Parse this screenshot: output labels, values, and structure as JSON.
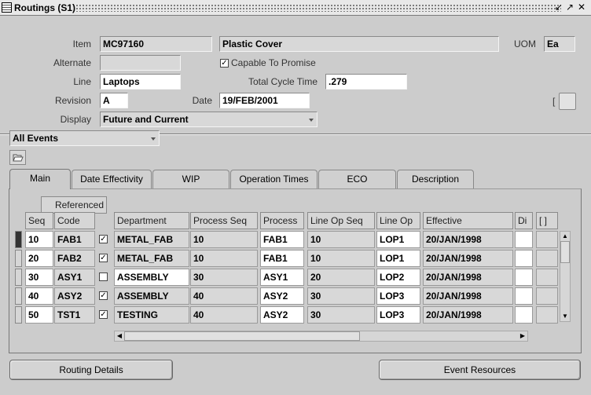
{
  "window": {
    "title": "Routings (S1)"
  },
  "header": {
    "item_label": "Item",
    "item_value": "MC97160",
    "item_desc": "Plastic Cover",
    "uom_label": "UOM",
    "uom_value": "Ea",
    "alternate_label": "Alternate",
    "alternate_value": "",
    "ctp_label": "Capable To Promise",
    "ctp_checked": "✓",
    "line_label": "Line",
    "line_value": "Laptops",
    "cycle_label": "Total Cycle Time",
    "cycle_value": ".279",
    "revision_label": "Revision",
    "revision_value": "A",
    "date_label": "Date",
    "date_value": "19/FEB/2001",
    "display_label": "Display",
    "display_value": "Future and Current",
    "bracket": "[",
    "events_value": "All Events"
  },
  "tabs": [
    {
      "label": "Main"
    },
    {
      "label": "Date Effectivity"
    },
    {
      "label": "WIP"
    },
    {
      "label": "Operation Times"
    },
    {
      "label": "ECO"
    },
    {
      "label": "Description"
    }
  ],
  "table": {
    "group_header": "Referenced",
    "headers": [
      "Seq",
      "Code",
      "Department",
      "Process Seq",
      "Process",
      "Line Op Seq",
      "Line Op",
      "Effective",
      "Di",
      "[ ]"
    ],
    "rows": [
      {
        "seq": "10",
        "code": "FAB1",
        "ref": "✓",
        "dept": "METAL_FAB",
        "pseq": "10",
        "proc": "FAB1",
        "lopseq": "10",
        "lop": "LOP1",
        "eff": "20/JAN/1998"
      },
      {
        "seq": "20",
        "code": "FAB2",
        "ref": "✓",
        "dept": "METAL_FAB",
        "pseq": "10",
        "proc": "FAB1",
        "lopseq": "10",
        "lop": "LOP1",
        "eff": "20/JAN/1998"
      },
      {
        "seq": "30",
        "code": "ASY1",
        "ref": "",
        "dept": "ASSEMBLY",
        "pseq": "30",
        "proc": "ASY1",
        "lopseq": "20",
        "lop": "LOP2",
        "eff": "20/JAN/1998"
      },
      {
        "seq": "40",
        "code": "ASY2",
        "ref": "✓",
        "dept": "ASSEMBLY",
        "pseq": "40",
        "proc": "ASY2",
        "lopseq": "30",
        "lop": "LOP3",
        "eff": "20/JAN/1998"
      },
      {
        "seq": "50",
        "code": "TST1",
        "ref": "✓",
        "dept": "TESTING",
        "pseq": "40",
        "proc": "ASY2",
        "lopseq": "30",
        "lop": "LOP3",
        "eff": "20/JAN/1998"
      }
    ]
  },
  "buttons": {
    "routing_details": "Routing Details",
    "event_resources": "Event Resources"
  },
  "icons": {
    "app": "oracle-forms-icon",
    "folder": "folder-open-icon"
  }
}
